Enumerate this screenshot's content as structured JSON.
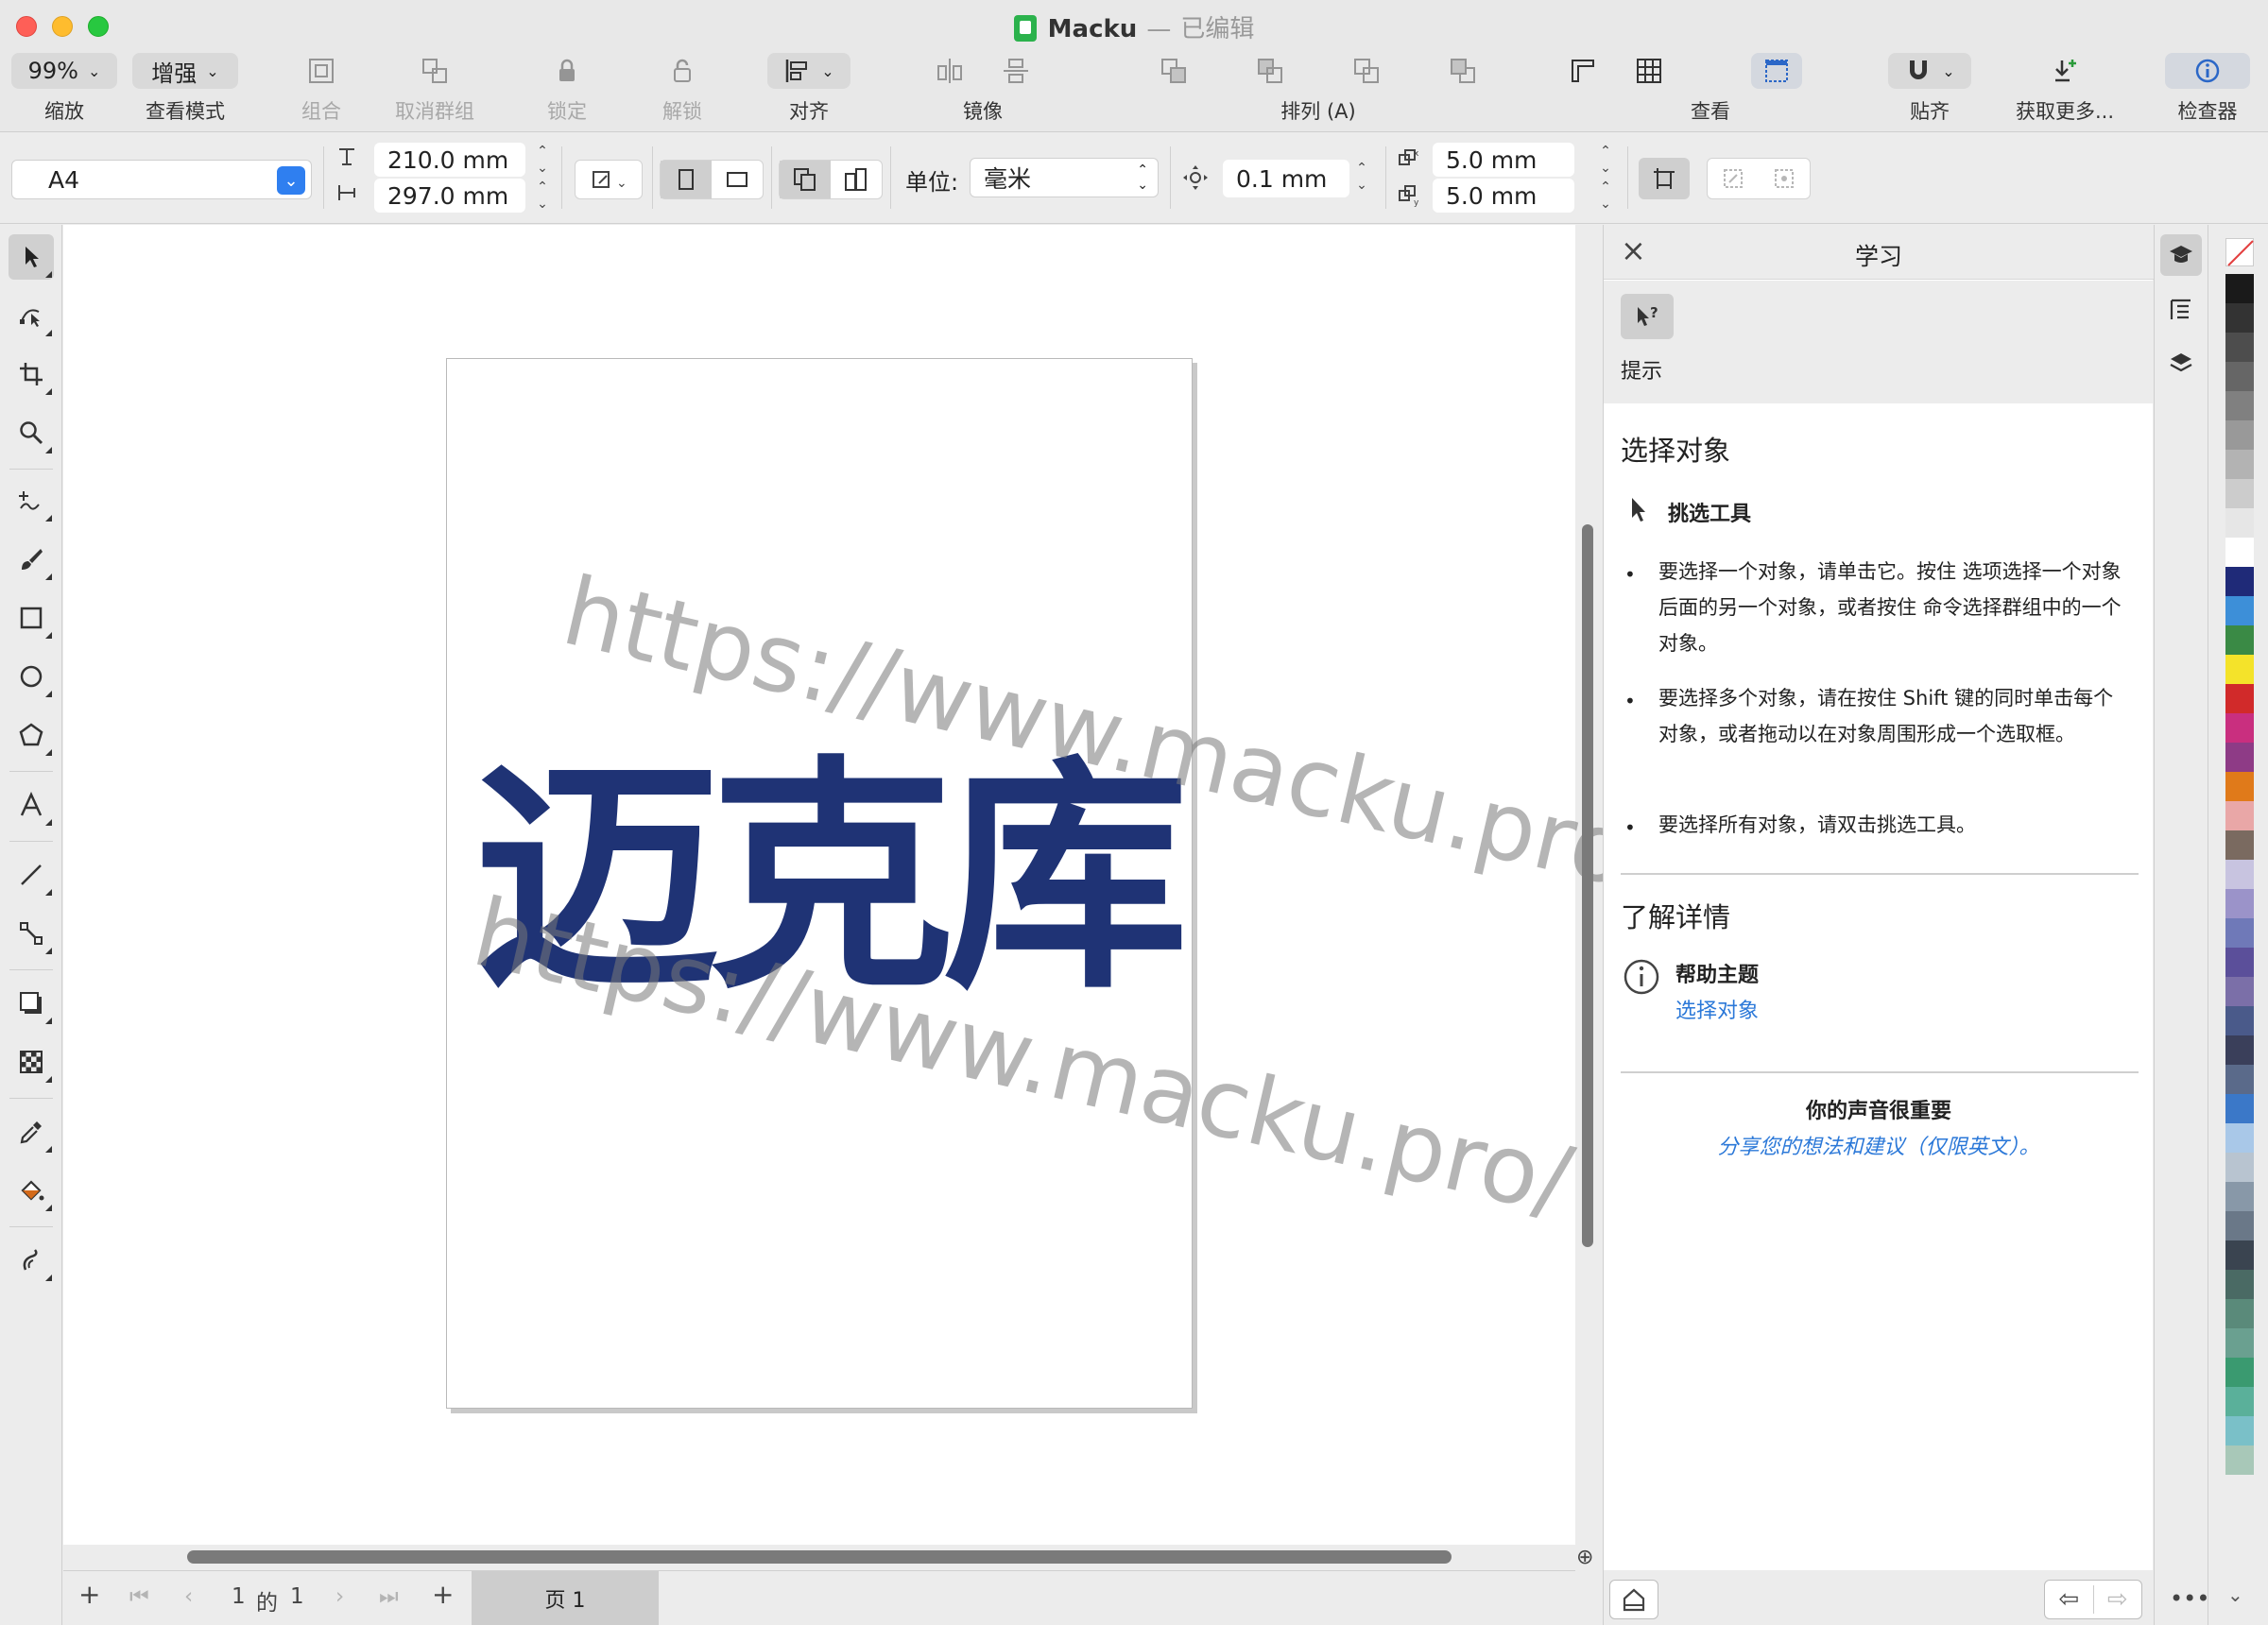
{
  "window": {
    "app_name": "Macku",
    "separator": "—",
    "status": "已编辑"
  },
  "toolbar": {
    "zoom": {
      "value": "99%",
      "label": "缩放"
    },
    "view_mode": {
      "value": "增强",
      "label": "查看模式"
    },
    "group": "组合",
    "ungroup": "取消群组",
    "lock": "锁定",
    "unlock": "解锁",
    "align": "对齐",
    "mirror": "镜像",
    "arrange": "排列 (A)",
    "view": "查看",
    "snap": "贴齐",
    "get_more": "获取更多...",
    "inspector": "检查器"
  },
  "propbar": {
    "page_size": "A4",
    "width": "210.0 mm",
    "height": "297.0 mm",
    "unit_label": "单位:",
    "unit_value": "毫米",
    "nudge": "0.1 mm",
    "dup_x": "5.0 mm",
    "dup_y": "5.0 mm"
  },
  "canvas": {
    "logo_text": "迈克库",
    "watermark": "https://www.macku.pro/"
  },
  "pagebar": {
    "add": "+",
    "first": "⏮",
    "prev": "‹",
    "current": "1",
    "of": "的",
    "total": "1",
    "next": "›",
    "last": "⏭",
    "add_after": "+",
    "tab": "页 1"
  },
  "panel": {
    "title": "学习",
    "hint_label": "提示",
    "section_title": "选择对象",
    "tool_name": "挑选工具",
    "bullets": [
      "要选择一个对象，请单击它。按住 选项选择一个对象后面的另一个对象，或者按住 命令选择群组中的一个对象。",
      "要选择多个对象，请在按住 Shift 键的同时单击每个对象，或者拖动以在对象周围形成一个选取框。",
      "要选择所有对象，请双击挑选工具。"
    ],
    "learn_more": "了解详情",
    "help_topic": "帮助主题",
    "help_link": "选择对象",
    "feedback_title": "你的声音很重要",
    "feedback_link": "分享您的想法和建议（仅限英文）。"
  },
  "palette": {
    "colors": [
      "#1a1a1a",
      "#333333",
      "#4d4d4d",
      "#666666",
      "#808080",
      "#999999",
      "#b3b3b3",
      "#cccccc",
      "#e6e6e6",
      "#ffffff",
      "#1f2a78",
      "#3d8fd8",
      "#3a8a45",
      "#f4e32a",
      "#d12a2a",
      "#c92f7f",
      "#8e3b86",
      "#e07a1a",
      "#e9a7a7",
      "#7a6a60",
      "#c8c4e0",
      "#9b93c9",
      "#6f79b8",
      "#5b4f9a",
      "#7b6fa8",
      "#4a5a8a",
      "#3a3f5a",
      "#5a6a8a",
      "#3b78c8",
      "#a9c8e8",
      "#b8c4d0",
      "#8898a8",
      "#6a7888",
      "#3a4450",
      "#4a6a64",
      "#5a8a7a",
      "#6aa090",
      "#3a9a70",
      "#5ab09a",
      "#7ac0c8",
      "#a8c8b8"
    ]
  }
}
